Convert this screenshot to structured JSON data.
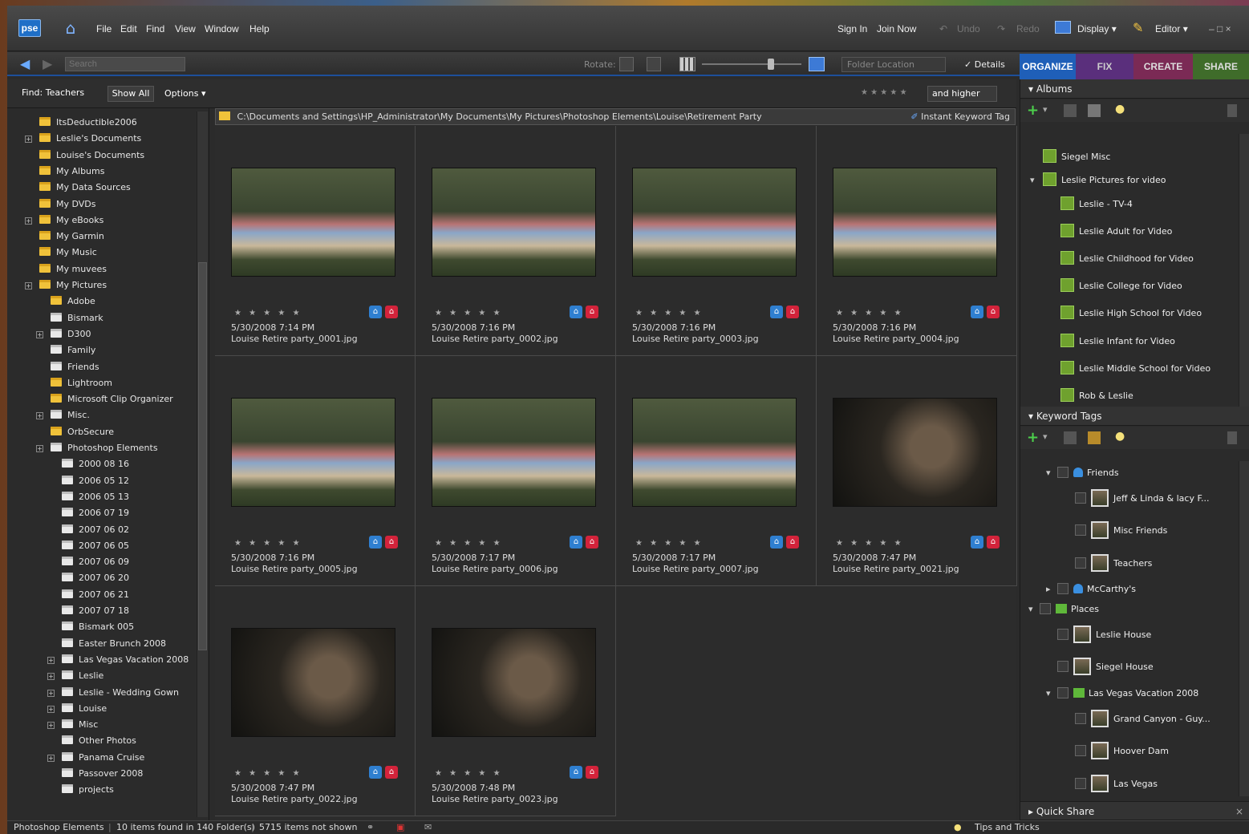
{
  "menubar": {
    "logo": "pse",
    "menus": [
      "File",
      "Edit",
      "Find",
      "View",
      "Window",
      "Help"
    ],
    "sign_in": "Sign In",
    "join_now": "Join Now",
    "undo": "Undo",
    "redo": "Redo",
    "display": "Display",
    "editor": "Editor",
    "win_controls": "– □ ×"
  },
  "toolbar": {
    "search_placeholder": "Search",
    "rotate_label": "Rotate:",
    "folder_location": "Folder Location",
    "details": "Details"
  },
  "tabs": [
    {
      "label": "ORGANIZE",
      "color": "#1f5fb8"
    },
    {
      "label": "FIX",
      "color": "#5a2f7c"
    },
    {
      "label": "CREATE",
      "color": "#7b2a55"
    },
    {
      "label": "SHARE",
      "color": "#3f6c2a"
    }
  ],
  "findbar": {
    "find": "Find: Teachers",
    "show_all": "Show All",
    "options": "Options",
    "rating": "★ ★ ★ ★ ★",
    "and_higher": "and higher"
  },
  "tree": [
    {
      "label": "ItsDeductible2006",
      "indent": 0,
      "plus": false,
      "type": "yellow"
    },
    {
      "label": "Leslie's Documents",
      "indent": 0,
      "plus": true,
      "type": "yellow"
    },
    {
      "label": "Louise's Documents",
      "indent": 0,
      "plus": false,
      "type": "yellow"
    },
    {
      "label": "My Albums",
      "indent": 0,
      "plus": false,
      "type": "yellow"
    },
    {
      "label": "My Data Sources",
      "indent": 0,
      "plus": false,
      "type": "yellow"
    },
    {
      "label": "My DVDs",
      "indent": 0,
      "plus": false,
      "type": "yellow"
    },
    {
      "label": "My eBooks",
      "indent": 0,
      "plus": true,
      "type": "yellow"
    },
    {
      "label": "My Garmin",
      "indent": 0,
      "plus": false,
      "type": "yellow"
    },
    {
      "label": "My Music",
      "indent": 0,
      "plus": false,
      "type": "yellow"
    },
    {
      "label": "My muvees",
      "indent": 0,
      "plus": false,
      "type": "yellow"
    },
    {
      "label": "My Pictures",
      "indent": 0,
      "plus": true,
      "type": "yellow"
    },
    {
      "label": "Adobe",
      "indent": 1,
      "plus": false,
      "type": "yellow"
    },
    {
      "label": "Bismark",
      "indent": 1,
      "plus": false,
      "type": "gray"
    },
    {
      "label": "D300",
      "indent": 1,
      "plus": true,
      "type": "gray"
    },
    {
      "label": "Family",
      "indent": 1,
      "plus": false,
      "type": "gray"
    },
    {
      "label": "Friends",
      "indent": 1,
      "plus": false,
      "type": "gray"
    },
    {
      "label": "Lightroom",
      "indent": 1,
      "plus": false,
      "type": "yellow"
    },
    {
      "label": "Microsoft Clip Organizer",
      "indent": 1,
      "plus": false,
      "type": "yellow"
    },
    {
      "label": "Misc.",
      "indent": 1,
      "plus": true,
      "type": "gray"
    },
    {
      "label": "OrbSecure",
      "indent": 1,
      "plus": false,
      "type": "yellow"
    },
    {
      "label": "Photoshop Elements",
      "indent": 1,
      "plus": true,
      "type": "gray"
    },
    {
      "label": "2000 08 16",
      "indent": 2,
      "plus": false,
      "type": "gray"
    },
    {
      "label": "2006 05 12",
      "indent": 2,
      "plus": false,
      "type": "gray"
    },
    {
      "label": "2006 05 13",
      "indent": 2,
      "plus": false,
      "type": "gray"
    },
    {
      "label": "2006 07 19",
      "indent": 2,
      "plus": false,
      "type": "gray"
    },
    {
      "label": "2007 06 02",
      "indent": 2,
      "plus": false,
      "type": "gray"
    },
    {
      "label": "2007 06 05",
      "indent": 2,
      "plus": false,
      "type": "gray"
    },
    {
      "label": "2007 06 09",
      "indent": 2,
      "plus": false,
      "type": "gray"
    },
    {
      "label": "2007 06 20",
      "indent": 2,
      "plus": false,
      "type": "gray"
    },
    {
      "label": "2007 06 21",
      "indent": 2,
      "plus": false,
      "type": "gray"
    },
    {
      "label": "2007 07 18",
      "indent": 2,
      "plus": false,
      "type": "gray"
    },
    {
      "label": "Bismark 005",
      "indent": 2,
      "plus": false,
      "type": "gray"
    },
    {
      "label": "Easter Brunch 2008",
      "indent": 2,
      "plus": false,
      "type": "gray"
    },
    {
      "label": "Las Vegas Vacation 2008",
      "indent": 2,
      "plus": true,
      "type": "gray"
    },
    {
      "label": "Leslie",
      "indent": 2,
      "plus": true,
      "type": "gray"
    },
    {
      "label": "Leslie - Wedding Gown",
      "indent": 2,
      "plus": true,
      "type": "gray"
    },
    {
      "label": "Louise",
      "indent": 2,
      "plus": true,
      "type": "gray"
    },
    {
      "label": "Misc",
      "indent": 2,
      "plus": true,
      "type": "gray"
    },
    {
      "label": "Other Photos",
      "indent": 2,
      "plus": false,
      "type": "gray"
    },
    {
      "label": "Panama Cruise",
      "indent": 2,
      "plus": true,
      "type": "gray"
    },
    {
      "label": "Passover 2008",
      "indent": 2,
      "plus": false,
      "type": "gray"
    },
    {
      "label": "projects",
      "indent": 2,
      "plus": false,
      "type": "gray"
    }
  ],
  "path": "C:\\Documents and Settings\\HP_Administrator\\My Documents\\My Pictures\\Photoshop Elements\\Louise\\Retirement Party",
  "instant_keyword": "Instant Keyword Tag",
  "photos": [
    {
      "date": "5/30/2008 7:14 PM",
      "name": "Louise Retire party_0001.jpg",
      "night": false
    },
    {
      "date": "5/30/2008 7:16 PM",
      "name": "Louise Retire party_0002.jpg",
      "night": false
    },
    {
      "date": "5/30/2008 7:16 PM",
      "name": "Louise Retire party_0003.jpg",
      "night": false
    },
    {
      "date": "5/30/2008 7:16 PM",
      "name": "Louise Retire party_0004.jpg",
      "night": false
    },
    {
      "date": "5/30/2008 7:16 PM",
      "name": "Louise Retire party_0005.jpg",
      "night": false
    },
    {
      "date": "5/30/2008 7:17 PM",
      "name": "Louise Retire party_0006.jpg",
      "night": false
    },
    {
      "date": "5/30/2008 7:17 PM",
      "name": "Louise Retire party_0007.jpg",
      "night": false
    },
    {
      "date": "5/30/2008 7:47 PM",
      "name": "Louise Retire party_0021.jpg",
      "night": true
    },
    {
      "date": "5/30/2008 7:47 PM",
      "name": "Louise Retire party_0022.jpg",
      "night": true
    },
    {
      "date": "5/30/2008 7:48 PM",
      "name": "Louise Retire party_0023.jpg",
      "night": true
    }
  ],
  "photo_stars": "★ ★ ★ ★ ★",
  "albums": {
    "header": "Albums",
    "items": [
      {
        "label": "Siegel Misc",
        "indent": 0,
        "arrow": ""
      },
      {
        "label": "Leslie Pictures for video",
        "indent": 0,
        "arrow": "▾"
      },
      {
        "label": "Leslie - TV-4",
        "indent": 1,
        "arrow": ""
      },
      {
        "label": "Leslie Adult for Video",
        "indent": 1,
        "arrow": ""
      },
      {
        "label": "Leslie Childhood for Video",
        "indent": 1,
        "arrow": ""
      },
      {
        "label": "Leslie College for Video",
        "indent": 1,
        "arrow": ""
      },
      {
        "label": "Leslie High School for Video",
        "indent": 1,
        "arrow": ""
      },
      {
        "label": "Leslie Infant for Video",
        "indent": 1,
        "arrow": ""
      },
      {
        "label": "Leslie Middle School for Video",
        "indent": 1,
        "arrow": ""
      },
      {
        "label": "Rob & Leslie",
        "indent": 1,
        "arrow": ""
      }
    ]
  },
  "keywords": {
    "header": "Keyword Tags",
    "items": [
      {
        "label": "Friends",
        "kind": "cat",
        "arrow": "▾",
        "indent": 1
      },
      {
        "label": "Jeff & Linda & lacy F...",
        "kind": "thumb",
        "arrow": "",
        "indent": 2
      },
      {
        "label": "Misc Friends",
        "kind": "thumb",
        "arrow": "",
        "indent": 2
      },
      {
        "label": "Teachers",
        "kind": "thumb",
        "arrow": "",
        "indent": 2
      },
      {
        "label": "McCarthy's",
        "kind": "cat",
        "arrow": "▸",
        "indent": 1
      },
      {
        "label": "Places",
        "kind": "place",
        "arrow": "▾",
        "indent": 0
      },
      {
        "label": "Leslie House",
        "kind": "thumb",
        "arrow": "",
        "indent": 1
      },
      {
        "label": "Siegel House",
        "kind": "thumb",
        "arrow": "",
        "indent": 1
      },
      {
        "label": "Las Vegas Vacation 2008",
        "kind": "place",
        "arrow": "▾",
        "indent": 1
      },
      {
        "label": "Grand Canyon - Guy...",
        "kind": "thumb",
        "arrow": "",
        "indent": 2
      },
      {
        "label": "Hoover Dam",
        "kind": "thumb",
        "arrow": "",
        "indent": 2
      },
      {
        "label": "Las Vegas",
        "kind": "thumb",
        "arrow": "",
        "indent": 2
      }
    ]
  },
  "quick_share": "Quick Share",
  "status": {
    "app": "Photoshop Elements",
    "found": "10 items found in 140 Folder(s)",
    "not_shown": "5715 items not shown",
    "tips": "Tips and Tricks"
  }
}
